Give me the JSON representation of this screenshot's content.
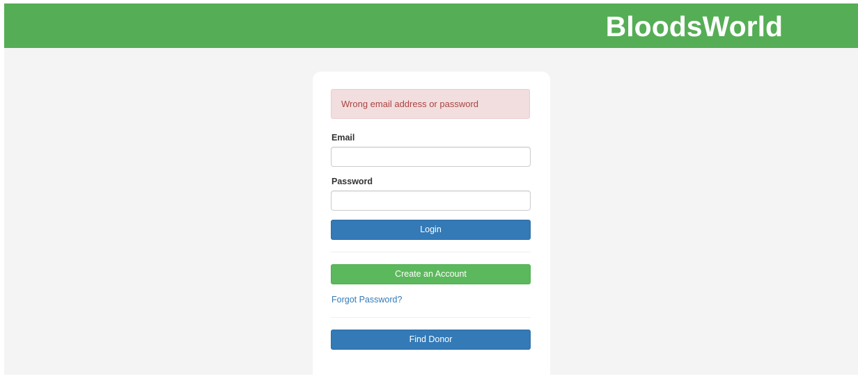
{
  "header": {
    "brand": "BloodsWorld"
  },
  "login": {
    "error_message": "Wrong email address or password",
    "email_label": "Email",
    "email_value": "",
    "password_label": "Password",
    "password_value": "",
    "login_button": "Login",
    "create_account_button": "Create an Account",
    "forgot_password_link": "Forgot Password?",
    "find_donor_button": "Find Donor"
  },
  "colors": {
    "header_background": "#55ae55",
    "page_background": "#f4f4f4",
    "primary_button": "#337ab7",
    "success_button": "#5cb85c",
    "alert_background": "#f2dede",
    "alert_text": "#a94442",
    "link": "#337ab7"
  }
}
